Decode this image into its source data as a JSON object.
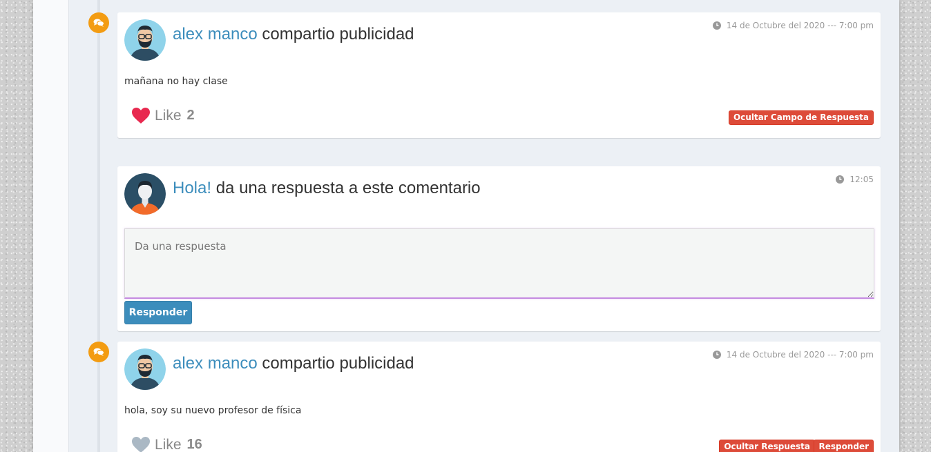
{
  "posts": [
    {
      "user": "alex manco",
      "action": "compartio publicidad",
      "timestamp": "14 de Octubre del 2020 --- 7:00 pm",
      "text": "mañana no hay clase",
      "like_label": "Like",
      "like_count": "2",
      "liked": true,
      "buttons": [
        "Ocultar Campo de Respuesta"
      ]
    },
    {
      "user": "alex manco",
      "action": "compartio publicidad",
      "timestamp": "14 de Octubre del 2020 --- 7:00 pm",
      "text": "hola, soy su nuevo profesor de física",
      "like_label": "Like",
      "like_count": "16",
      "liked": false,
      "buttons": [
        "Ocultar Respuesta",
        "Responder"
      ]
    }
  ],
  "reply_card": {
    "greeting": "Hola!",
    "prompt": "da una respuesta a este comentario",
    "time": "12:05",
    "placeholder": "Da una respuesta",
    "submit_label": "Responder"
  },
  "colors": {
    "accent": "#3c8dbc",
    "danger": "#dd4b39",
    "timeline_icon": "#f39c12",
    "heart_liked": "#e8294f",
    "heart_unliked": "#aab8c4"
  },
  "icons": {
    "timeline": "comments-icon",
    "time": "clock-icon",
    "like": "heart-icon"
  }
}
